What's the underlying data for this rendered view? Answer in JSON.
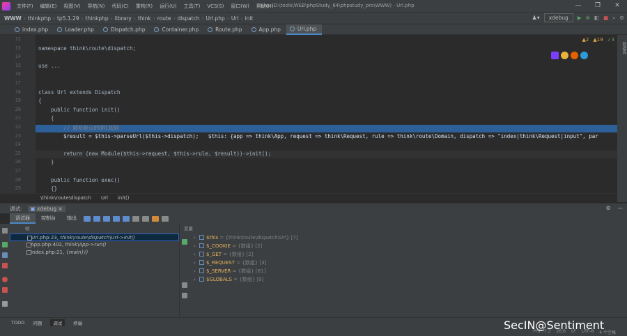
{
  "menubar": {
    "items": [
      "文件(F)",
      "编辑(E)",
      "视图(V)",
      "导航(N)",
      "代码(C)",
      "重构(R)",
      "运行(U)",
      "工具(T)",
      "VCS(S)",
      "窗口(W)",
      "帮助(H)"
    ],
    "title": "l.php (D:\\tools\\WEB\\phpStudy_64\\phpstudy_pro\\WWW) - Url.php",
    "window_controls": [
      "—",
      "❐",
      "✕"
    ]
  },
  "navbar": {
    "crumbs": [
      "WWW",
      "thinkphp",
      "tp5.1.29",
      "thinkphp",
      "library",
      "think",
      "route",
      "dispatch",
      "Url.php",
      "Url",
      "init"
    ],
    "run_config": "xdebug"
  },
  "tabs": [
    {
      "label": "index.php"
    },
    {
      "label": "Loader.php"
    },
    {
      "label": "Dispatch.php"
    },
    {
      "label": "Container.php"
    },
    {
      "label": "Route.php"
    },
    {
      "label": "App.php"
    },
    {
      "label": "Url.php",
      "active": true
    }
  ],
  "editor": {
    "inspections": {
      "warnings": "2",
      "weak_warnings": "19",
      "typos": "3"
    },
    "line_numbers": [
      "12",
      "13",
      "14",
      "15",
      "16",
      "17",
      "18",
      "19",
      "20",
      "21",
      "22",
      "23",
      "24",
      "25",
      "26",
      "27",
      "28",
      "29"
    ],
    "lines": [
      "",
      "namespace think\\route\\dispatch;",
      "",
      "use ...",
      "",
      "",
      "class Url extends Dispatch",
      "{",
      "    public function init()",
      "    {",
      "        // 解析默认的URL规则",
      "        $result = $this->parseUrl($this->dispatch);   $this: {app => think\\App, request => think\\Request, rule => think\\route\\Domain, dispatch => \"index|think\\Request|input\", par",
      "",
      "        return (new Module($this->request, $this->rule, $result))->init();",
      "    }",
      "",
      "    public function exec()",
      "    {}"
    ],
    "breadcrumb": [
      "\\think\\route\\dispatch",
      "Url",
      "init()"
    ]
  },
  "debug": {
    "header_label": "调试:",
    "session": "xdebug",
    "tabs": [
      "调试器",
      "控制台",
      "输出"
    ],
    "frames_header": "帧",
    "frames": [
      {
        "file": "Url.php:23,",
        "method": "think\\route\\dispatch\\Url->init()",
        "selected": true
      },
      {
        "file": "App.php:402,",
        "method": "think\\App->run()"
      },
      {
        "file": "index.php:21,",
        "method": "{main}()"
      }
    ],
    "vars_header": "变量",
    "variables": [
      {
        "name": "$this",
        "value": " = {think\\route\\dispatch\\Url} [7]"
      },
      {
        "name": "$_COOKIE",
        "value": " = {数组} [2]"
      },
      {
        "name": "$_GET",
        "value": " = {数组} [2]"
      },
      {
        "name": "$_REQUEST",
        "value": " = {数组} [3]"
      },
      {
        "name": "$_SERVER",
        "value": " = {数组} [81]"
      },
      {
        "name": "$GLOBALS",
        "value": " = {数组} [9]"
      }
    ]
  },
  "bottom_tabs": [
    "TODO",
    "问题",
    "调试",
    "终端"
  ],
  "status": {
    "php": "PHP: 7.3",
    "position": "26:6",
    "line_sep": "LF",
    "encoding": "UTF-8",
    "indent": "4 个空格"
  },
  "watermark": "SecIN@Sentiment",
  "colors": {
    "accent": "#2f65ca",
    "highlight": "#2d6099"
  }
}
